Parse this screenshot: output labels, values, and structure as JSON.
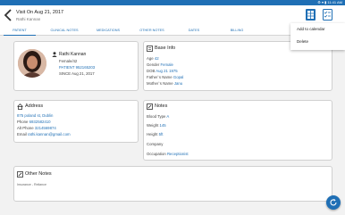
{
  "status_bar": {
    "text": "⚙ ▾ ▮ 11:41 AM"
  },
  "header": {
    "title": "Visit On Aug 21, 2017",
    "subtitle": "Rathi Kannan"
  },
  "tabs": [
    {
      "label": "PATIENT"
    },
    {
      "label": "CLINICAL NOTES"
    },
    {
      "label": "MEDICATIONS"
    },
    {
      "label": "OTHER NOTES"
    },
    {
      "label": "DATES"
    },
    {
      "label": "BILLING"
    }
  ],
  "menu": {
    "items": [
      {
        "label": "Add to calendar"
      },
      {
        "label": "Delete"
      }
    ]
  },
  "patient": {
    "name": "Rathi Kannan",
    "sex_age": "Female/42",
    "patient_label": "PATIENT",
    "patient_id": "952165203",
    "since": "SINCE Aug 21, 2017"
  },
  "base_info": {
    "title": "Base Info",
    "rows": [
      {
        "label": "Age",
        "value": "42"
      },
      {
        "label": "Gender",
        "value": "Female"
      },
      {
        "label": "DOB",
        "value": "Aug 21 1975"
      },
      {
        "label": "Father`s Name",
        "value": "Gopal"
      },
      {
        "label": "Mother`s Name",
        "value": "Janu"
      }
    ]
  },
  "address": {
    "title": "Address",
    "line": "875 poland st, Dublin",
    "phone_label": "Phone",
    "phone": "6932582410",
    "alt_phone_label": "Alt Phone",
    "alt_phone": "3214569874",
    "email_label": "Email",
    "email": "rathi.kannan@gmail.com"
  },
  "notes": {
    "title": "Notes",
    "rows": [
      {
        "label": "Blood Type",
        "value": "A"
      },
      {
        "label": "Weight",
        "value": "145"
      },
      {
        "label": "Height",
        "value": "5ft"
      },
      {
        "label": "Company",
        "value": ""
      },
      {
        "label": "Occupation",
        "value": "Receptionist"
      }
    ]
  },
  "other_notes": {
    "title": "Other Notes",
    "text": "Insurance - Reliance"
  },
  "colors": {
    "accent": "#1f6fb5",
    "background": "#f2f2f2"
  }
}
